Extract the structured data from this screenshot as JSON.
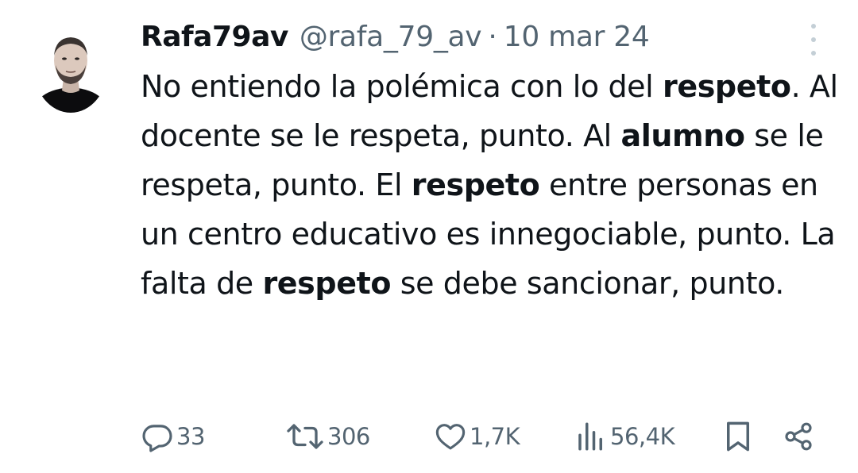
{
  "tweet": {
    "author": {
      "display_name": "Rafa79av",
      "handle": "@rafa_79_av"
    },
    "separator": "·",
    "date": "10 mar 24",
    "text_segments": [
      {
        "text": "No entiendo la polémica con lo del ",
        "bold": false
      },
      {
        "text": "respeto",
        "bold": true
      },
      {
        "text": ". Al docente se le respeta, punto. Al ",
        "bold": false
      },
      {
        "text": "alumno",
        "bold": true
      },
      {
        "text": " se le respeta, punto. El ",
        "bold": false
      },
      {
        "text": "respeto",
        "bold": true
      },
      {
        "text": " entre personas en un centro educativo es innegociable, punto. La falta de ",
        "bold": false
      },
      {
        "text": "respeto",
        "bold": true
      },
      {
        "text": " se debe sancionar, punto.",
        "bold": false
      }
    ],
    "metrics": {
      "replies": "33",
      "retweets": "306",
      "likes": "1,7K",
      "views": "56,4K"
    }
  },
  "icons": {
    "more": "more-vertical-icon",
    "reply": "reply-icon",
    "retweet": "retweet-icon",
    "like": "heart-icon",
    "views": "views-icon",
    "bookmark": "bookmark-icon",
    "share": "share-icon"
  },
  "colors": {
    "text_primary": "#0f1419",
    "text_secondary": "#536471",
    "more_dots": "#c4cfd6"
  }
}
